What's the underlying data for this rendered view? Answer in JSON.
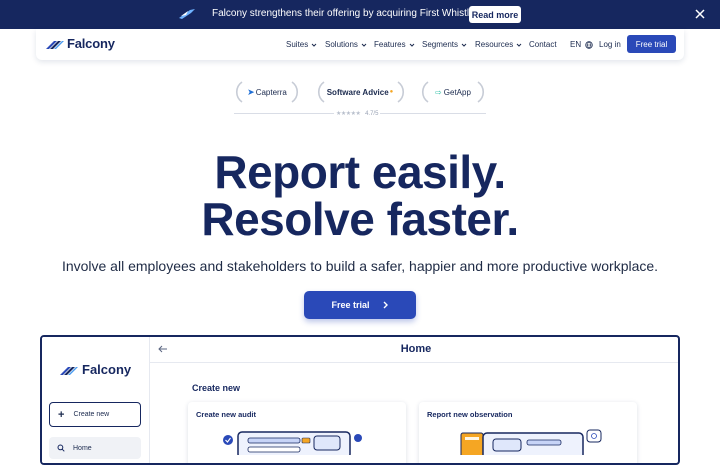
{
  "announcement": {
    "message": "Falcony strengthens their offering by acquiring First Whistle",
    "button_label": "Read more"
  },
  "brand": {
    "name": "Falcony",
    "primary_color": "#16275f",
    "accent_color": "#2a49b8"
  },
  "nav": {
    "items": [
      "Suites",
      "Solutions",
      "Features",
      "Segments",
      "Resources"
    ],
    "contact": "Contact",
    "language": "EN",
    "login": "Log in",
    "cta": "Free trial"
  },
  "badges": {
    "capterra": "Capterra",
    "software_advice": "Software Advice",
    "getapp": "GetApp",
    "rating": "4.7/5"
  },
  "hero": {
    "line1": "Report easily.",
    "line2": "Resolve faster.",
    "subtitle": "Involve all employees and stakeholders to build a safer, happier and more productive workplace.",
    "cta": "Free trial"
  },
  "app_preview": {
    "brand": "Falcony",
    "create_button": "Create new",
    "home_item": "Home",
    "page_title": "Home",
    "section_title": "Create new",
    "cards": [
      "Create new audit",
      "Report new observation"
    ]
  }
}
